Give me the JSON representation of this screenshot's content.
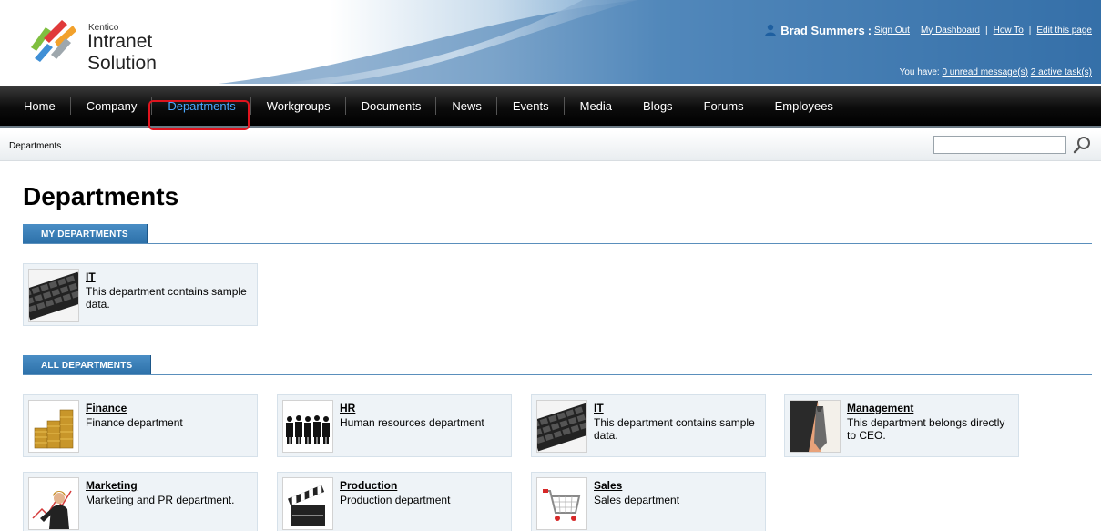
{
  "header": {
    "brand_small": "Kentico",
    "brand_name": "Intranet Solution",
    "user_name": "Brad Summers",
    "links": {
      "sign_out": "Sign Out",
      "dashboard": "My Dashboard",
      "how_to": "How To",
      "edit_page": "Edit this page"
    },
    "separator": "|",
    "colon": ":",
    "you_have": "You have:",
    "unread_messages": "0 unread message(s)",
    "active_tasks": "2 active task(s)"
  },
  "nav": {
    "items": [
      "Home",
      "Company",
      "Departments",
      "Workgroups",
      "Documents",
      "News",
      "Events",
      "Media",
      "Blogs",
      "Forums",
      "Employees"
    ],
    "active": "Departments"
  },
  "breadcrumb": "Departments",
  "search": {
    "value": "",
    "placeholder": ""
  },
  "page": {
    "title": "Departments",
    "my_departments_label": "MY DEPARTMENTS",
    "all_departments_label": "ALL DEPARTMENTS"
  },
  "my_departments": [
    {
      "name": "IT",
      "description": "This department contains sample data.",
      "icon": "keyboard-icon"
    }
  ],
  "all_departments": [
    {
      "name": "Finance",
      "description": "Finance department",
      "icon": "coins-icon"
    },
    {
      "name": "HR",
      "description": "Human resources department",
      "icon": "people-icon"
    },
    {
      "name": "IT",
      "description": "This department contains sample data.",
      "icon": "keyboard-icon"
    },
    {
      "name": "Management",
      "description": "This department belongs directly to CEO.",
      "icon": "tie-icon"
    },
    {
      "name": "Marketing",
      "description": "Marketing and PR department.",
      "icon": "marketing-icon"
    },
    {
      "name": "Production",
      "description": "Production department",
      "icon": "clapperboard-icon"
    },
    {
      "name": "Sales",
      "description": "Sales department",
      "icon": "shopping-cart-icon"
    }
  ],
  "colors": {
    "nav_active": "#4aa8ff",
    "section_tab": "#2b6fa8",
    "card_bg": "#eef3f7",
    "highlight": "#e0141e"
  }
}
